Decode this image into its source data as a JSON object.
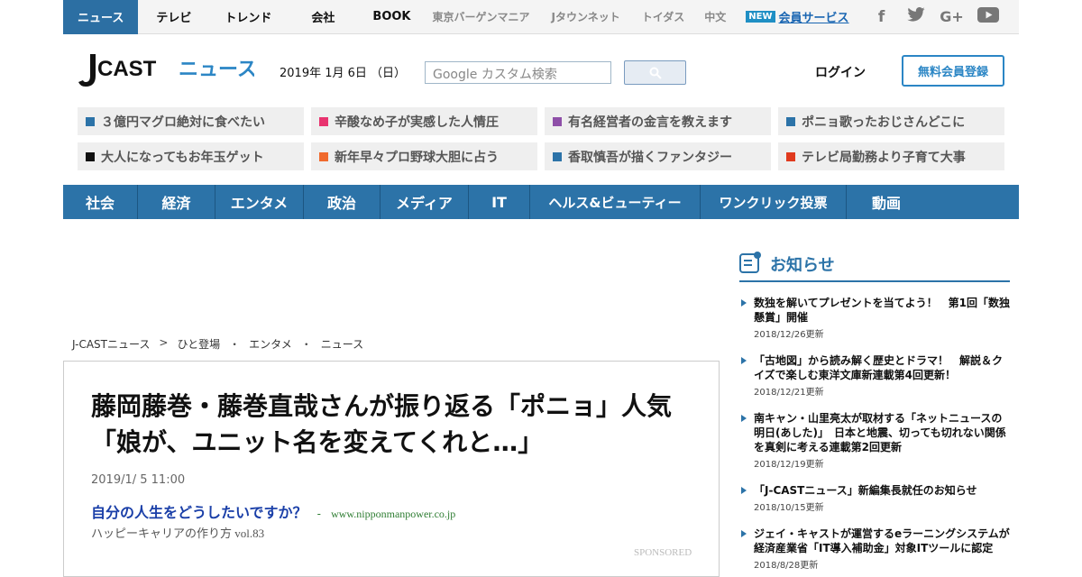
{
  "topnav": {
    "items": [
      {
        "label": "ニュース",
        "active": true
      },
      {
        "label": "テレビ"
      },
      {
        "label": "トレンド"
      },
      {
        "label": "会社"
      },
      {
        "label": "BOOK"
      },
      {
        "label": "東京バーゲンマニア"
      },
      {
        "label": "Jタウンネット"
      },
      {
        "label": "トイダス"
      },
      {
        "label": "中文"
      }
    ],
    "new_badge": "NEW",
    "member_service": "会員サービス",
    "social_icons": [
      "facebook-icon",
      "twitter-icon",
      "google-plus-icon",
      "youtube-icon"
    ]
  },
  "header": {
    "logo_text_j": "J",
    "logo_text_cast": "CAST",
    "logo_text_news": "ニュース",
    "date": "2019年 1月 6日 （日）",
    "search_placeholder": "Google カスタム検索",
    "login": "ログイン",
    "register": "無料会員登録"
  },
  "topics": [
    {
      "label": "３億円マグロ絶対に食べたい",
      "color": "#2c73a8"
    },
    {
      "label": "辛酸なめ子が実感した人情圧",
      "color": "#e8336f"
    },
    {
      "label": "有名経営者の金言を教えます",
      "color": "#8e4fa8"
    },
    {
      "label": "ポニョ歌ったおじさんどこに",
      "color": "#2c73a8"
    },
    {
      "label": "大人になってもお年玉ゲット",
      "color": "#111111"
    },
    {
      "label": "新年早々プロ野球大胆に占う",
      "color": "#f06a2d"
    },
    {
      "label": "香取慎吾が描くファンタジー",
      "color": "#2c73a8"
    },
    {
      "label": "テレビ局勤務より子育て大事",
      "color": "#e03a1e"
    }
  ],
  "categories": [
    {
      "label": "社会"
    },
    {
      "label": "経済"
    },
    {
      "label": "エンタメ"
    },
    {
      "label": "政治"
    },
    {
      "label": "メディア"
    },
    {
      "label": "IT"
    },
    {
      "label": "ヘルス&ビューティー"
    },
    {
      "label": "ワンクリック投票"
    },
    {
      "label": "動画"
    }
  ],
  "breadcrumb": [
    "J-CASTニュース",
    "ひと登場",
    "エンタメ",
    "ニュース"
  ],
  "breadcrumb_seps": [
    ">",
    "・",
    "・"
  ],
  "article": {
    "title": "藤岡藤巻・藤巻直哉さんが振り返る「ポニョ」人気　「娘が、ユニット名を変えてくれと…」",
    "date": "2019/1/ 5 11:00",
    "ad_title": "自分の人生をどうしたいですか？",
    "ad_sep": "-",
    "ad_url": "www.nipponmanpower.co.jp",
    "ad_sub": "ハッピーキャリアの作り方 vol.83",
    "sponsored": "SPONSORED"
  },
  "sidebar": {
    "title": "お知らせ",
    "news": [
      {
        "title": "数独を解いてプレゼントを当てよう！　第1回「数独懸賞」開催",
        "date": "2018/12/26更新"
      },
      {
        "title": "「古地図」から読み解く歴史とドラマ！　解説＆クイズで楽しむ東洋文庫新連載第4回更新！",
        "date": "2018/12/21更新"
      },
      {
        "title": "南キャン・山里亮太が取材する「ネットニュースの明日(あした)」　日本と地震、切っても切れない関係を真剣に考える連載第2回更新",
        "date": "2018/12/19更新"
      },
      {
        "title": "「J-CASTニュース」新編集長就任のお知らせ",
        "date": "2018/10/15更新"
      },
      {
        "title": "ジェイ・キャストが運営するeラーニングシステムが経済産業省「IT導入補助金」対象ITツールに認定",
        "date": "2018/8/28更新"
      }
    ]
  }
}
